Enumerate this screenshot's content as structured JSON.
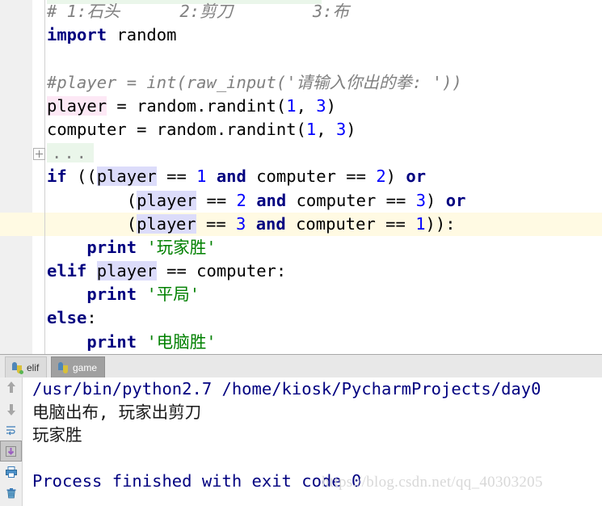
{
  "editor": {
    "lines": [
      {
        "id": "l1",
        "indent": 0,
        "caret": false,
        "tokens": [
          {
            "t": "comment",
            "s": "# 1:石头      2:剪刀        3:布"
          }
        ]
      },
      {
        "id": "l2",
        "indent": 0,
        "caret": false,
        "tokens": [
          {
            "t": "keyword",
            "s": "import"
          },
          {
            "t": "plain",
            "s": " random"
          }
        ]
      },
      {
        "id": "l3",
        "indent": 0,
        "caret": false,
        "tokens": []
      },
      {
        "id": "l4",
        "indent": 0,
        "caret": false,
        "tokens": [
          {
            "t": "comment",
            "s": "#player = int(raw_input('请输入你出的拳: '))"
          }
        ]
      },
      {
        "id": "l5",
        "indent": 0,
        "caret": false,
        "tokens": [
          {
            "t": "write",
            "s": "player"
          },
          {
            "t": "plain",
            "s": " = random.randint("
          },
          {
            "t": "number",
            "s": "1"
          },
          {
            "t": "plain",
            "s": ", "
          },
          {
            "t": "number",
            "s": "3"
          },
          {
            "t": "plain",
            "s": ")"
          }
        ]
      },
      {
        "id": "l6",
        "indent": 0,
        "caret": false,
        "tokens": [
          {
            "t": "plain",
            "s": "computer = random.randint("
          },
          {
            "t": "number",
            "s": "1"
          },
          {
            "t": "plain",
            "s": ", "
          },
          {
            "t": "number",
            "s": "3"
          },
          {
            "t": "plain",
            "s": ")"
          }
        ]
      },
      {
        "id": "l7",
        "indent": 0,
        "caret": false,
        "fold": true,
        "tokens": [
          {
            "t": "fold",
            "s": "..."
          }
        ]
      },
      {
        "id": "l8",
        "indent": 0,
        "caret": false,
        "tokens": [
          {
            "t": "keyword",
            "s": "if"
          },
          {
            "t": "plain",
            "s": " (("
          },
          {
            "t": "read",
            "s": "player"
          },
          {
            "t": "plain",
            "s": " == "
          },
          {
            "t": "number",
            "s": "1"
          },
          {
            "t": "plain",
            "s": " "
          },
          {
            "t": "keyword",
            "s": "and"
          },
          {
            "t": "plain",
            "s": " computer == "
          },
          {
            "t": "number",
            "s": "2"
          },
          {
            "t": "plain",
            "s": ") "
          },
          {
            "t": "keyword",
            "s": "or"
          }
        ]
      },
      {
        "id": "l9",
        "indent": 0,
        "caret": false,
        "tokens": [
          {
            "t": "plain",
            "s": "        ("
          },
          {
            "t": "read",
            "s": "player"
          },
          {
            "t": "plain",
            "s": " == "
          },
          {
            "t": "number",
            "s": "2"
          },
          {
            "t": "plain",
            "s": " "
          },
          {
            "t": "keyword",
            "s": "and"
          },
          {
            "t": "plain",
            "s": " computer == "
          },
          {
            "t": "number",
            "s": "3"
          },
          {
            "t": "plain",
            "s": ") "
          },
          {
            "t": "keyword",
            "s": "or"
          }
        ]
      },
      {
        "id": "l10",
        "indent": 0,
        "caret": true,
        "tokens": [
          {
            "t": "plain",
            "s": "        ("
          },
          {
            "t": "read",
            "s": "play",
            "caret_after": true
          },
          {
            "t": "read",
            "s": "er"
          },
          {
            "t": "plain",
            "s": " == "
          },
          {
            "t": "number",
            "s": "3"
          },
          {
            "t": "plain",
            "s": " "
          },
          {
            "t": "keyword",
            "s": "and"
          },
          {
            "t": "plain",
            "s": " computer == "
          },
          {
            "t": "number",
            "s": "1"
          },
          {
            "t": "plain",
            "s": ")):"
          }
        ]
      },
      {
        "id": "l11",
        "indent": 0,
        "caret": false,
        "tokens": [
          {
            "t": "plain",
            "s": "    "
          },
          {
            "t": "keyword",
            "s": "print"
          },
          {
            "t": "plain",
            "s": " "
          },
          {
            "t": "string",
            "s": "'玩家胜'"
          }
        ]
      },
      {
        "id": "l12",
        "indent": 0,
        "caret": false,
        "tokens": [
          {
            "t": "keyword",
            "s": "elif"
          },
          {
            "t": "plain",
            "s": " "
          },
          {
            "t": "read",
            "s": "player"
          },
          {
            "t": "plain",
            "s": " == computer:"
          }
        ]
      },
      {
        "id": "l13",
        "indent": 0,
        "caret": false,
        "tokens": [
          {
            "t": "plain",
            "s": "    "
          },
          {
            "t": "keyword",
            "s": "print"
          },
          {
            "t": "plain",
            "s": " "
          },
          {
            "t": "string",
            "s": "'平局'"
          }
        ]
      },
      {
        "id": "l14",
        "indent": 0,
        "caret": false,
        "tokens": [
          {
            "t": "keyword",
            "s": "else"
          },
          {
            "t": "plain",
            "s": ":"
          }
        ]
      },
      {
        "id": "l15",
        "indent": 0,
        "caret": false,
        "tokens": [
          {
            "t": "plain",
            "s": "    "
          },
          {
            "t": "keyword",
            "s": "print"
          },
          {
            "t": "plain",
            "s": " "
          },
          {
            "t": "string",
            "s": "'电脑胜'"
          }
        ]
      }
    ]
  },
  "run_window": {
    "tabs": [
      {
        "label": "elif",
        "icon": "python-file-icon",
        "active": false,
        "running_dot": true
      },
      {
        "label": "game",
        "icon": "python-file-icon",
        "active": true,
        "running_dot": false
      }
    ],
    "toolbar": [
      {
        "name": "scroll-up-button",
        "icon": "arrow-up-icon",
        "pressed": false
      },
      {
        "name": "scroll-down-button",
        "icon": "arrow-down-icon",
        "pressed": false
      },
      {
        "name": "soft-wrap-button",
        "icon": "soft-wrap-icon",
        "pressed": false
      },
      {
        "name": "scroll-to-end-button",
        "icon": "scroll-to-end-icon",
        "pressed": true
      },
      {
        "name": "print-button",
        "icon": "printer-icon",
        "pressed": false
      },
      {
        "name": "clear-all-button",
        "icon": "trash-icon",
        "pressed": false
      }
    ],
    "console_lines": [
      {
        "text": "/usr/bin/python2.7 /home/kiosk/PycharmProjects/day0",
        "color": "blue"
      },
      {
        "text": "电脑出布, 玩家出剪刀",
        "color": "black"
      },
      {
        "text": "玩家胜",
        "color": "black"
      },
      {
        "text": "",
        "color": "black"
      },
      {
        "text": "Process finished with exit code 0",
        "color": "blue"
      }
    ]
  },
  "watermark": {
    "text": "https://blog.csdn.net/qq_40303205"
  },
  "colors": {
    "keyword": "#000080",
    "number": "#0000ff",
    "string": "#008000",
    "comment": "#808080",
    "read_usage_highlight": "#dcdcfa",
    "write_usage_highlight": "#fde8f5",
    "caret_line": "#fffae3",
    "folded_region": "#eaf6ea",
    "gutter": "#f0f0f0",
    "console_text": "#000080"
  }
}
